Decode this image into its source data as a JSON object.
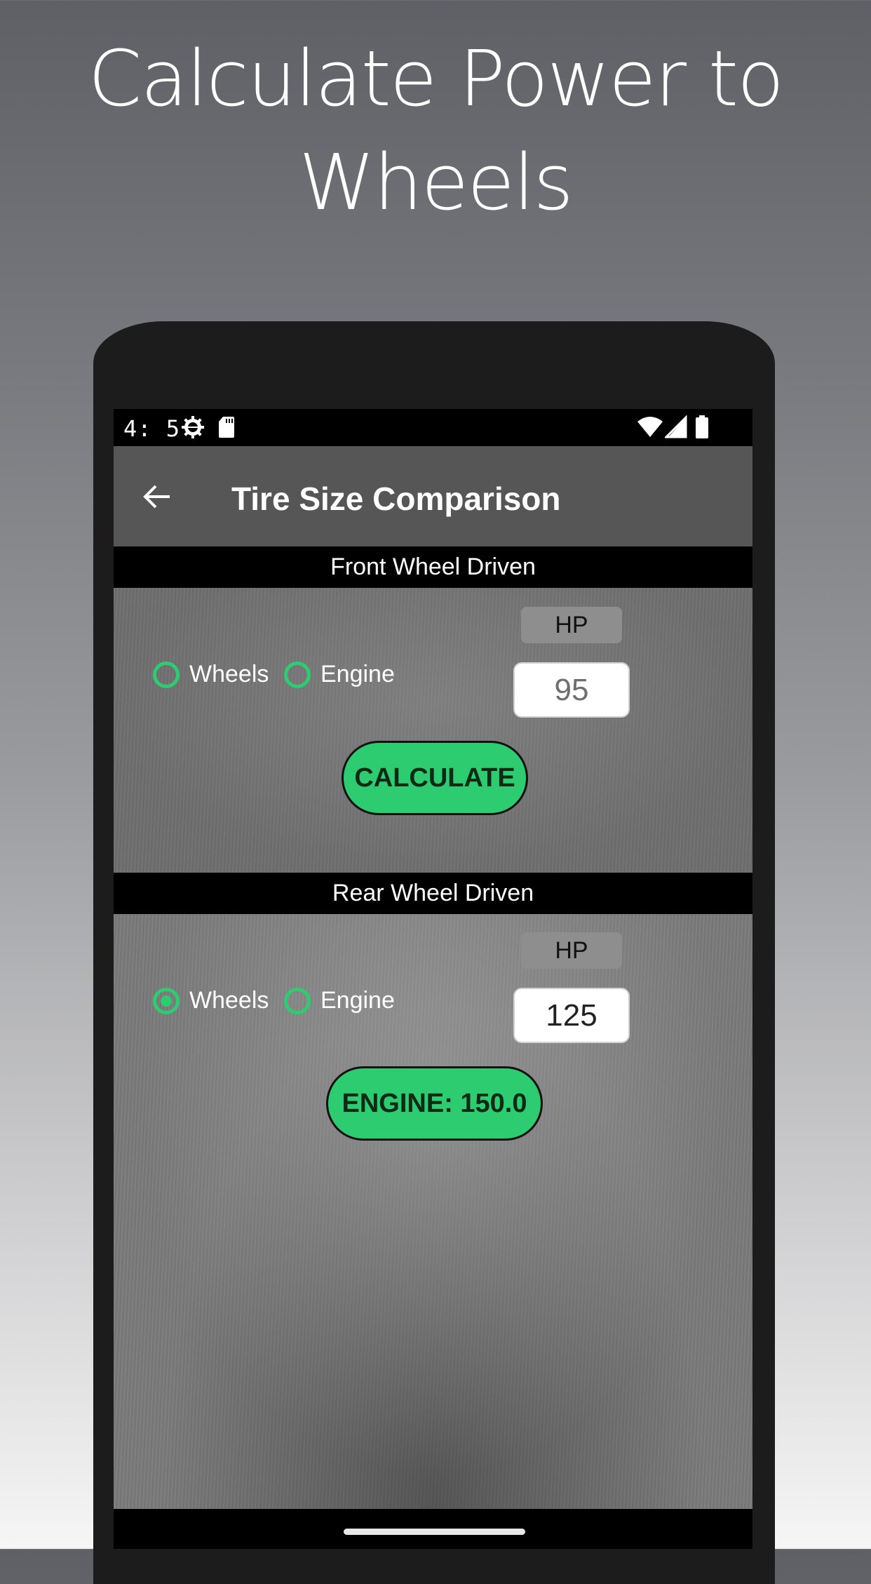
{
  "promo": {
    "title_line1": "Calculate Power to",
    "title_line2": "Wheels"
  },
  "status_bar": {
    "time": "4: 5",
    "left_icons": [
      "settings-gear-icon",
      "sd-card-icon"
    ],
    "right_icons": [
      "wifi-icon",
      "cell-signal-icon",
      "battery-icon"
    ]
  },
  "app_bar": {
    "back_icon": "arrow-left-icon",
    "title": "Tire Size Comparison"
  },
  "front": {
    "header": "Front Wheel Driven",
    "radio_wheels": "Wheels",
    "radio_engine": "Engine",
    "selected": "none",
    "hp_label": "HP",
    "hp_value": "95",
    "button_label": "CALCULATE"
  },
  "rear": {
    "header": "Rear Wheel Driven",
    "radio_wheels": "Wheels",
    "radio_engine": "Engine",
    "selected": "Wheels",
    "hp_label": "HP",
    "hp_value": "125",
    "button_label": "ENGINE: 150.0"
  },
  "colors": {
    "accent": "#2ecc71",
    "app_bar": "#565656",
    "section_header": "#000000"
  }
}
